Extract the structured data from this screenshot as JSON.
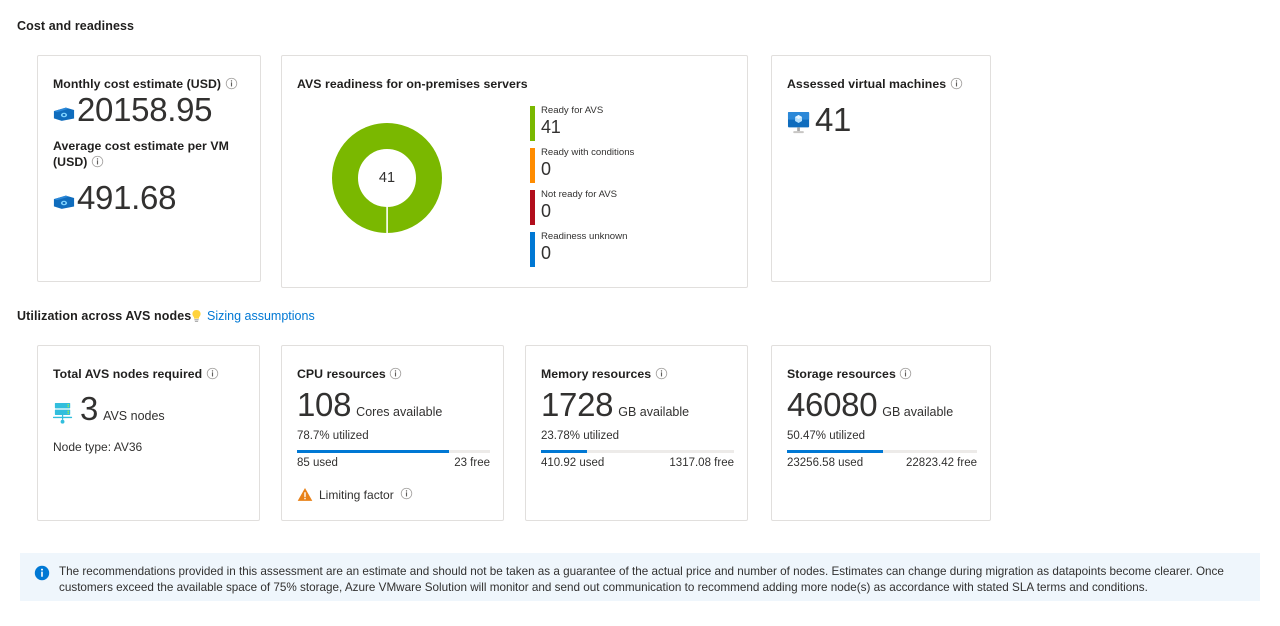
{
  "sections": {
    "cost_readiness": {
      "heading": "Cost and readiness"
    },
    "utilization": {
      "heading": "Utilization across AVS nodes",
      "link_label": "Sizing assumptions",
      "link_icon": "lightbulb-icon"
    }
  },
  "cost_card": {
    "monthly": {
      "title": "Monthly cost estimate (USD)",
      "info_icon": "info-icon",
      "icon": "money-icon",
      "value": "20158.95"
    },
    "average": {
      "title": "Average cost estimate per VM (USD)",
      "info_icon": "info-icon",
      "icon": "money-icon",
      "value": "491.68"
    }
  },
  "readiness_card": {
    "title": "AVS readiness for on-premises servers",
    "center_value": "41"
  },
  "assessed_card": {
    "title": "Assessed virtual machines",
    "info_icon": "info-icon",
    "icon": "virtual-machine-icon",
    "value": "41"
  },
  "nodes_card": {
    "title": "Total AVS nodes required",
    "info_icon": "info-icon",
    "icon": "server-rack-icon",
    "value": "3",
    "unit": "AVS nodes",
    "node_type": "Node type: AV36"
  },
  "cpu_card": {
    "title": "CPU resources",
    "info_icon": "info-icon",
    "value": "108",
    "unit": "Cores available",
    "utilized_label": "78.7% utilized",
    "utilized_pct": 78.7,
    "used": "85 used",
    "free": "23 free",
    "limiting_label": "Limiting factor",
    "limiting_icon": "warning-icon"
  },
  "memory_card": {
    "title": "Memory resources",
    "info_icon": "info-icon",
    "value": "1728",
    "unit": "GB available",
    "utilized_label": "23.78% utilized",
    "utilized_pct": 23.78,
    "used": "410.92 used",
    "free": "1317.08 free"
  },
  "storage_card": {
    "title": "Storage resources",
    "info_icon": "info-icon",
    "value": "46080",
    "unit": "GB available",
    "utilized_label": "50.47% utilized",
    "utilized_pct": 50.47,
    "used": "23256.58 used",
    "free": "22823.42 free"
  },
  "banner": {
    "icon": "info-filled-icon",
    "text": "The recommendations provided in this assessment are an estimate and should not be taken as a guarantee of the actual price and number of nodes. Estimates can change during migration as datapoints become clearer. Once customers exceed the available space of 75% storage, Azure VMware Solution will monitor and send out communication to recommend adding more node(s) as accordance with stated SLA terms and conditions."
  },
  "colors": {
    "ready": "#7ab800",
    "conditions": "#ff8c00",
    "not_ready": "#b10e1c",
    "unknown": "#0078d4",
    "accent": "#0078d4",
    "banner_bg": "#eff6fc",
    "card_border": "#e1dfdd",
    "track": "#edebe9"
  },
  "chart_data": {
    "type": "pie",
    "title": "AVS readiness for on-premises servers",
    "center_label": "41",
    "total": 41,
    "legend_position": "right",
    "labels": [
      "Ready for AVS",
      "Ready with conditions",
      "Not ready for AVS",
      "Readiness unknown"
    ],
    "values": [
      41,
      0,
      0,
      0
    ],
    "colors": [
      "#7ab800",
      "#ff8c00",
      "#b10e1c",
      "#0078d4"
    ]
  }
}
